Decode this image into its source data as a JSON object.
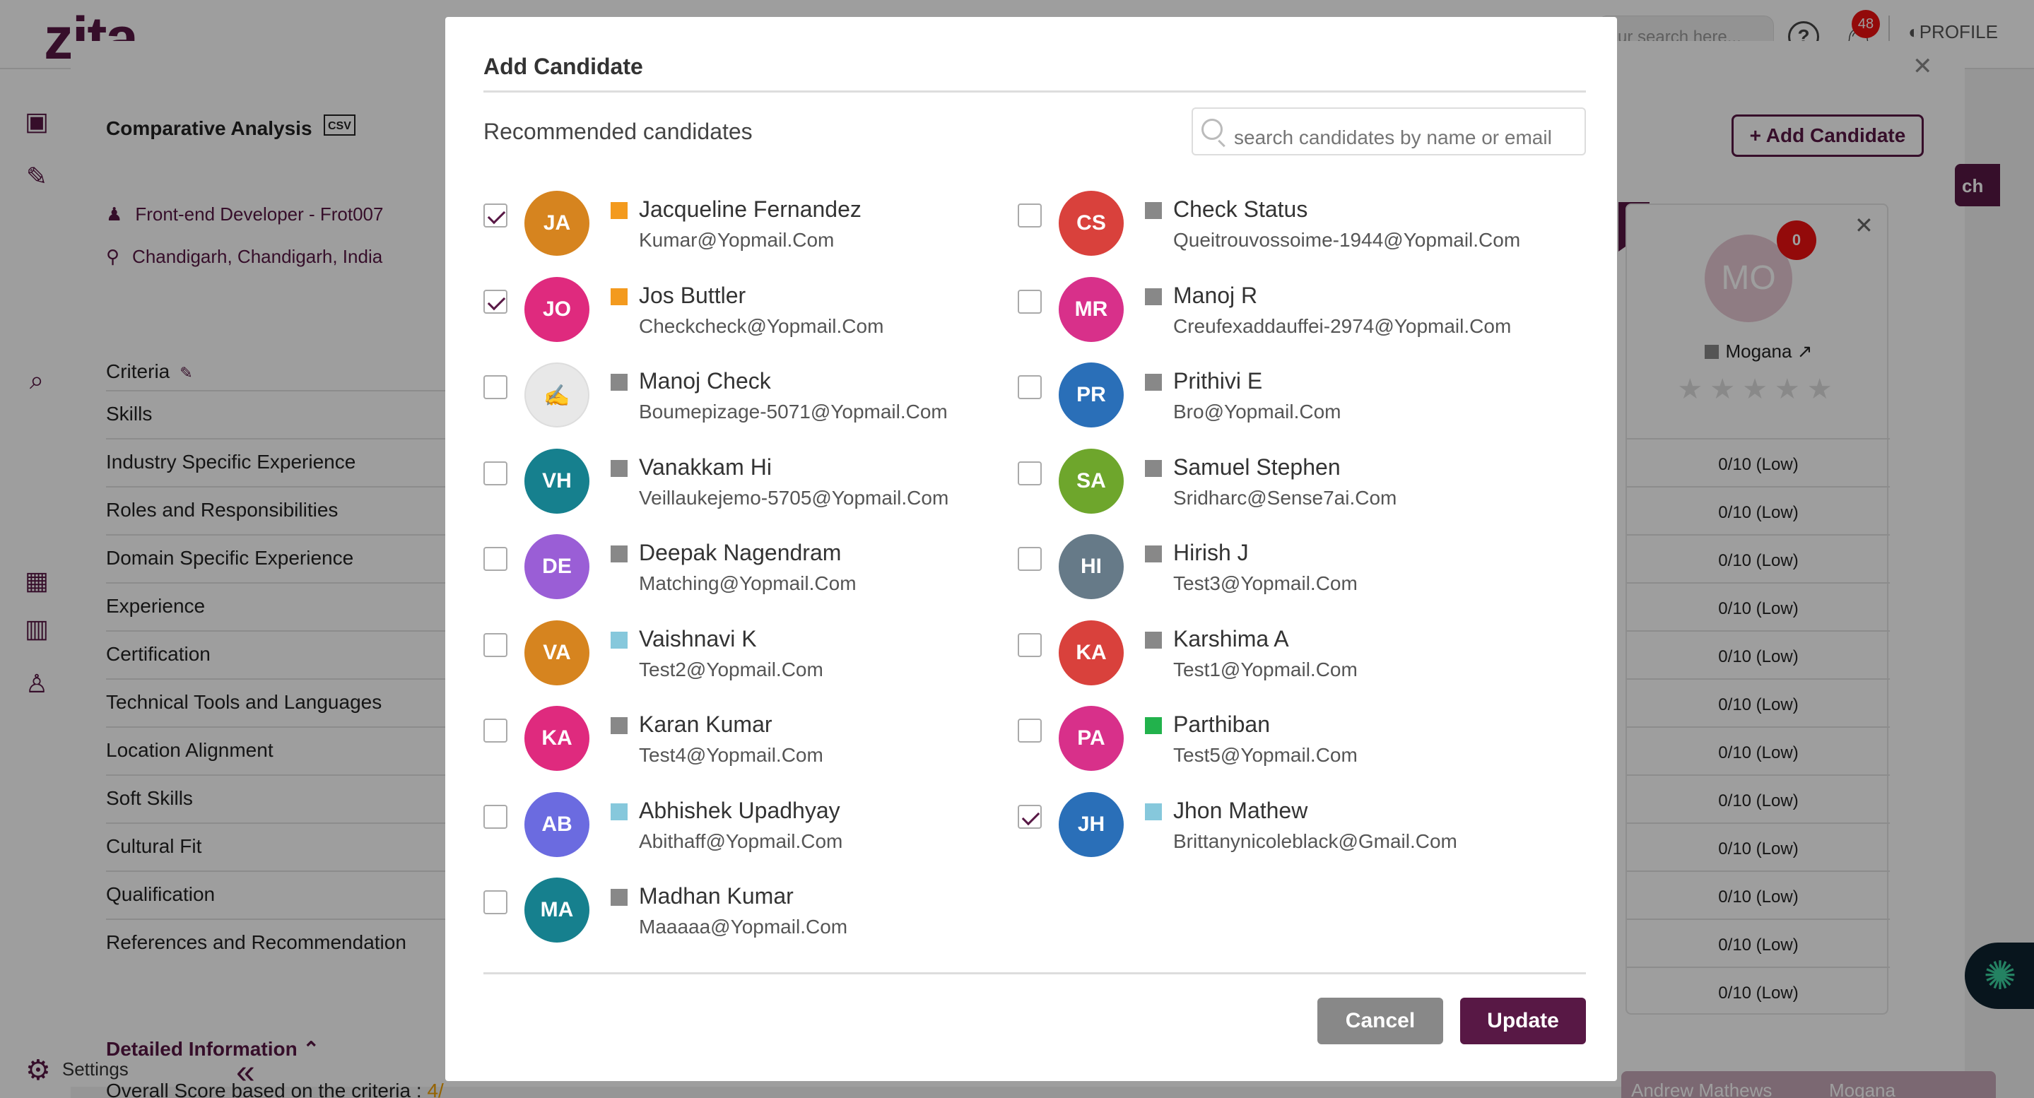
{
  "app": {
    "logo": "zita",
    "search_placeholder": "ur search here...",
    "notification_count": "48",
    "profile_label": "PROFILE",
    "settings_label": "Settings",
    "brand_color": "#581845"
  },
  "page": {
    "title": "Comparative Analysis",
    "csv_label": "CSV",
    "job_title": "Front-end Developer - Frot007",
    "location": "Chandigarh, Chandigarh, India",
    "criteria_label": "Criteria",
    "criteria": [
      "Skills",
      "Industry Specific Experience",
      "Roles and Responsibilities",
      "Domain Specific Experience",
      "Experience",
      "Certification",
      "Technical Tools and Languages",
      "Location Alignment",
      "Soft Skills",
      "Cultural Fit",
      "Qualification",
      "References and Recommendation"
    ],
    "detailed_label": "Detailed Information",
    "overall_label": "Overall Score based on the criteria :",
    "overall_value": "4/",
    "add_candidate_label": "Add Candidate",
    "match_label": "ch",
    "rank": "5",
    "card": {
      "initials": "MO",
      "badge": "0",
      "name": "Mogana",
      "scores": [
        "0/10 (Low)",
        "0/10 (Low)",
        "0/10 (Low)",
        "0/10 (Low)",
        "0/10 (Low)",
        "0/10 (Low)",
        "0/10 (Low)",
        "0/10 (Low)",
        "0/10 (Low)",
        "0/10 (Low)",
        "0/10 (Low)",
        "0/10 (Low)"
      ]
    },
    "bottom_tabs": [
      "Andrew Mathews",
      "Mogana"
    ]
  },
  "modal": {
    "title": "Add Candidate",
    "subtitle": "Recommended candidates",
    "search_placeholder": "search candidates by name or email",
    "cancel_label": "Cancel",
    "update_label": "Update",
    "candidates": [
      {
        "initials": "JA",
        "name": "Jacqueline Fernandez",
        "email": "Kumar@Yopmail.Com",
        "checked": true,
        "avatar_color": "#d6841f",
        "status_color": "#f39a1e"
      },
      {
        "initials": "CS",
        "name": "Check Status",
        "email": "Queitrouvossoime-1944@Yopmail.Com",
        "checked": false,
        "avatar_color": "#d9413c",
        "status_color": "#888888"
      },
      {
        "initials": "JO",
        "name": "Jos Buttler",
        "email": "Checkcheck@Yopmail.Com",
        "checked": true,
        "avatar_color": "#df2a7e",
        "status_color": "#f39a1e"
      },
      {
        "initials": "MR",
        "name": "Manoj R",
        "email": "Creufexaddauffei-2974@Yopmail.Com",
        "checked": false,
        "avatar_color": "#d8308a",
        "status_color": "#888888"
      },
      {
        "initials": "",
        "name": "Manoj Check",
        "email": "Boumepizage-5071@Yopmail.Com",
        "checked": false,
        "avatar_color": "#e8e8e8",
        "status_color": "#888888"
      },
      {
        "initials": "PR",
        "name": "Prithivi E",
        "email": "Bro@Yopmail.Com",
        "checked": false,
        "avatar_color": "#2a6fb8",
        "status_color": "#888888"
      },
      {
        "initials": "VH",
        "name": "Vanakkam Hi",
        "email": "Veillaukejemo-5705@Yopmail.Com",
        "checked": false,
        "avatar_color": "#16808e",
        "status_color": "#888888"
      },
      {
        "initials": "SA",
        "name": "Samuel Stephen",
        "email": "Sridharc@Sense7ai.Com",
        "checked": false,
        "avatar_color": "#6ea62c",
        "status_color": "#888888"
      },
      {
        "initials": "DE",
        "name": "Deepak Nagendram",
        "email": "Matching@Yopmail.Com",
        "checked": false,
        "avatar_color": "#9a5ed6",
        "status_color": "#888888"
      },
      {
        "initials": "HI",
        "name": "Hirish J",
        "email": "Test3@Yopmail.Com",
        "checked": false,
        "avatar_color": "#667a88",
        "status_color": "#888888"
      },
      {
        "initials": "VA",
        "name": "Vaishnavi K",
        "email": "Test2@Yopmail.Com",
        "checked": false,
        "avatar_color": "#d6841f",
        "status_color": "#86c8dc"
      },
      {
        "initials": "KA",
        "name": "Karshima A",
        "email": "Test1@Yopmail.Com",
        "checked": false,
        "avatar_color": "#d9413c",
        "status_color": "#888888"
      },
      {
        "initials": "KA",
        "name": "Karan Kumar",
        "email": "Test4@Yopmail.Com",
        "checked": false,
        "avatar_color": "#df2a7e",
        "status_color": "#888888"
      },
      {
        "initials": "PA",
        "name": "Parthiban",
        "email": "Test5@Yopmail.Com",
        "checked": false,
        "avatar_color": "#d8308a",
        "status_color": "#22b24c"
      },
      {
        "initials": "AB",
        "name": "Abhishek Upadhyay",
        "email": "Abithaff@Yopmail.Com",
        "checked": false,
        "avatar_color": "#6b6be0",
        "status_color": "#86c8dc"
      },
      {
        "initials": "JH",
        "name": "Jhon Mathew",
        "email": "Brittanynicoleblack@Gmail.Com",
        "checked": true,
        "avatar_color": "#2a6fb8",
        "status_color": "#86c8dc"
      },
      {
        "initials": "MA",
        "name": "Madhan Kumar",
        "email": "Maaaaa@Yopmail.Com",
        "checked": false,
        "avatar_color": "#16808e",
        "status_color": "#888888"
      }
    ]
  }
}
